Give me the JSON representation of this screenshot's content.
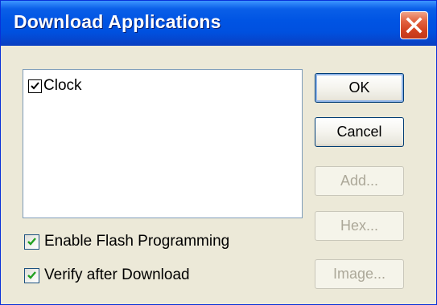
{
  "window": {
    "title": "Download Applications"
  },
  "applications": [
    {
      "label": "Clock",
      "checked": true
    }
  ],
  "options": {
    "enable_flash": {
      "label": "Enable Flash Programming",
      "checked": true
    },
    "verify_after": {
      "label": "Verify after Download",
      "checked": true
    }
  },
  "buttons": {
    "ok": "OK",
    "cancel": "Cancel",
    "add": "Add...",
    "hex": "Hex...",
    "image": "Image..."
  },
  "colors": {
    "titlebar": "#0054e3",
    "dialog_bg": "#ece9d8",
    "check_green": "#21a121",
    "disabled_text": "#aca899"
  }
}
